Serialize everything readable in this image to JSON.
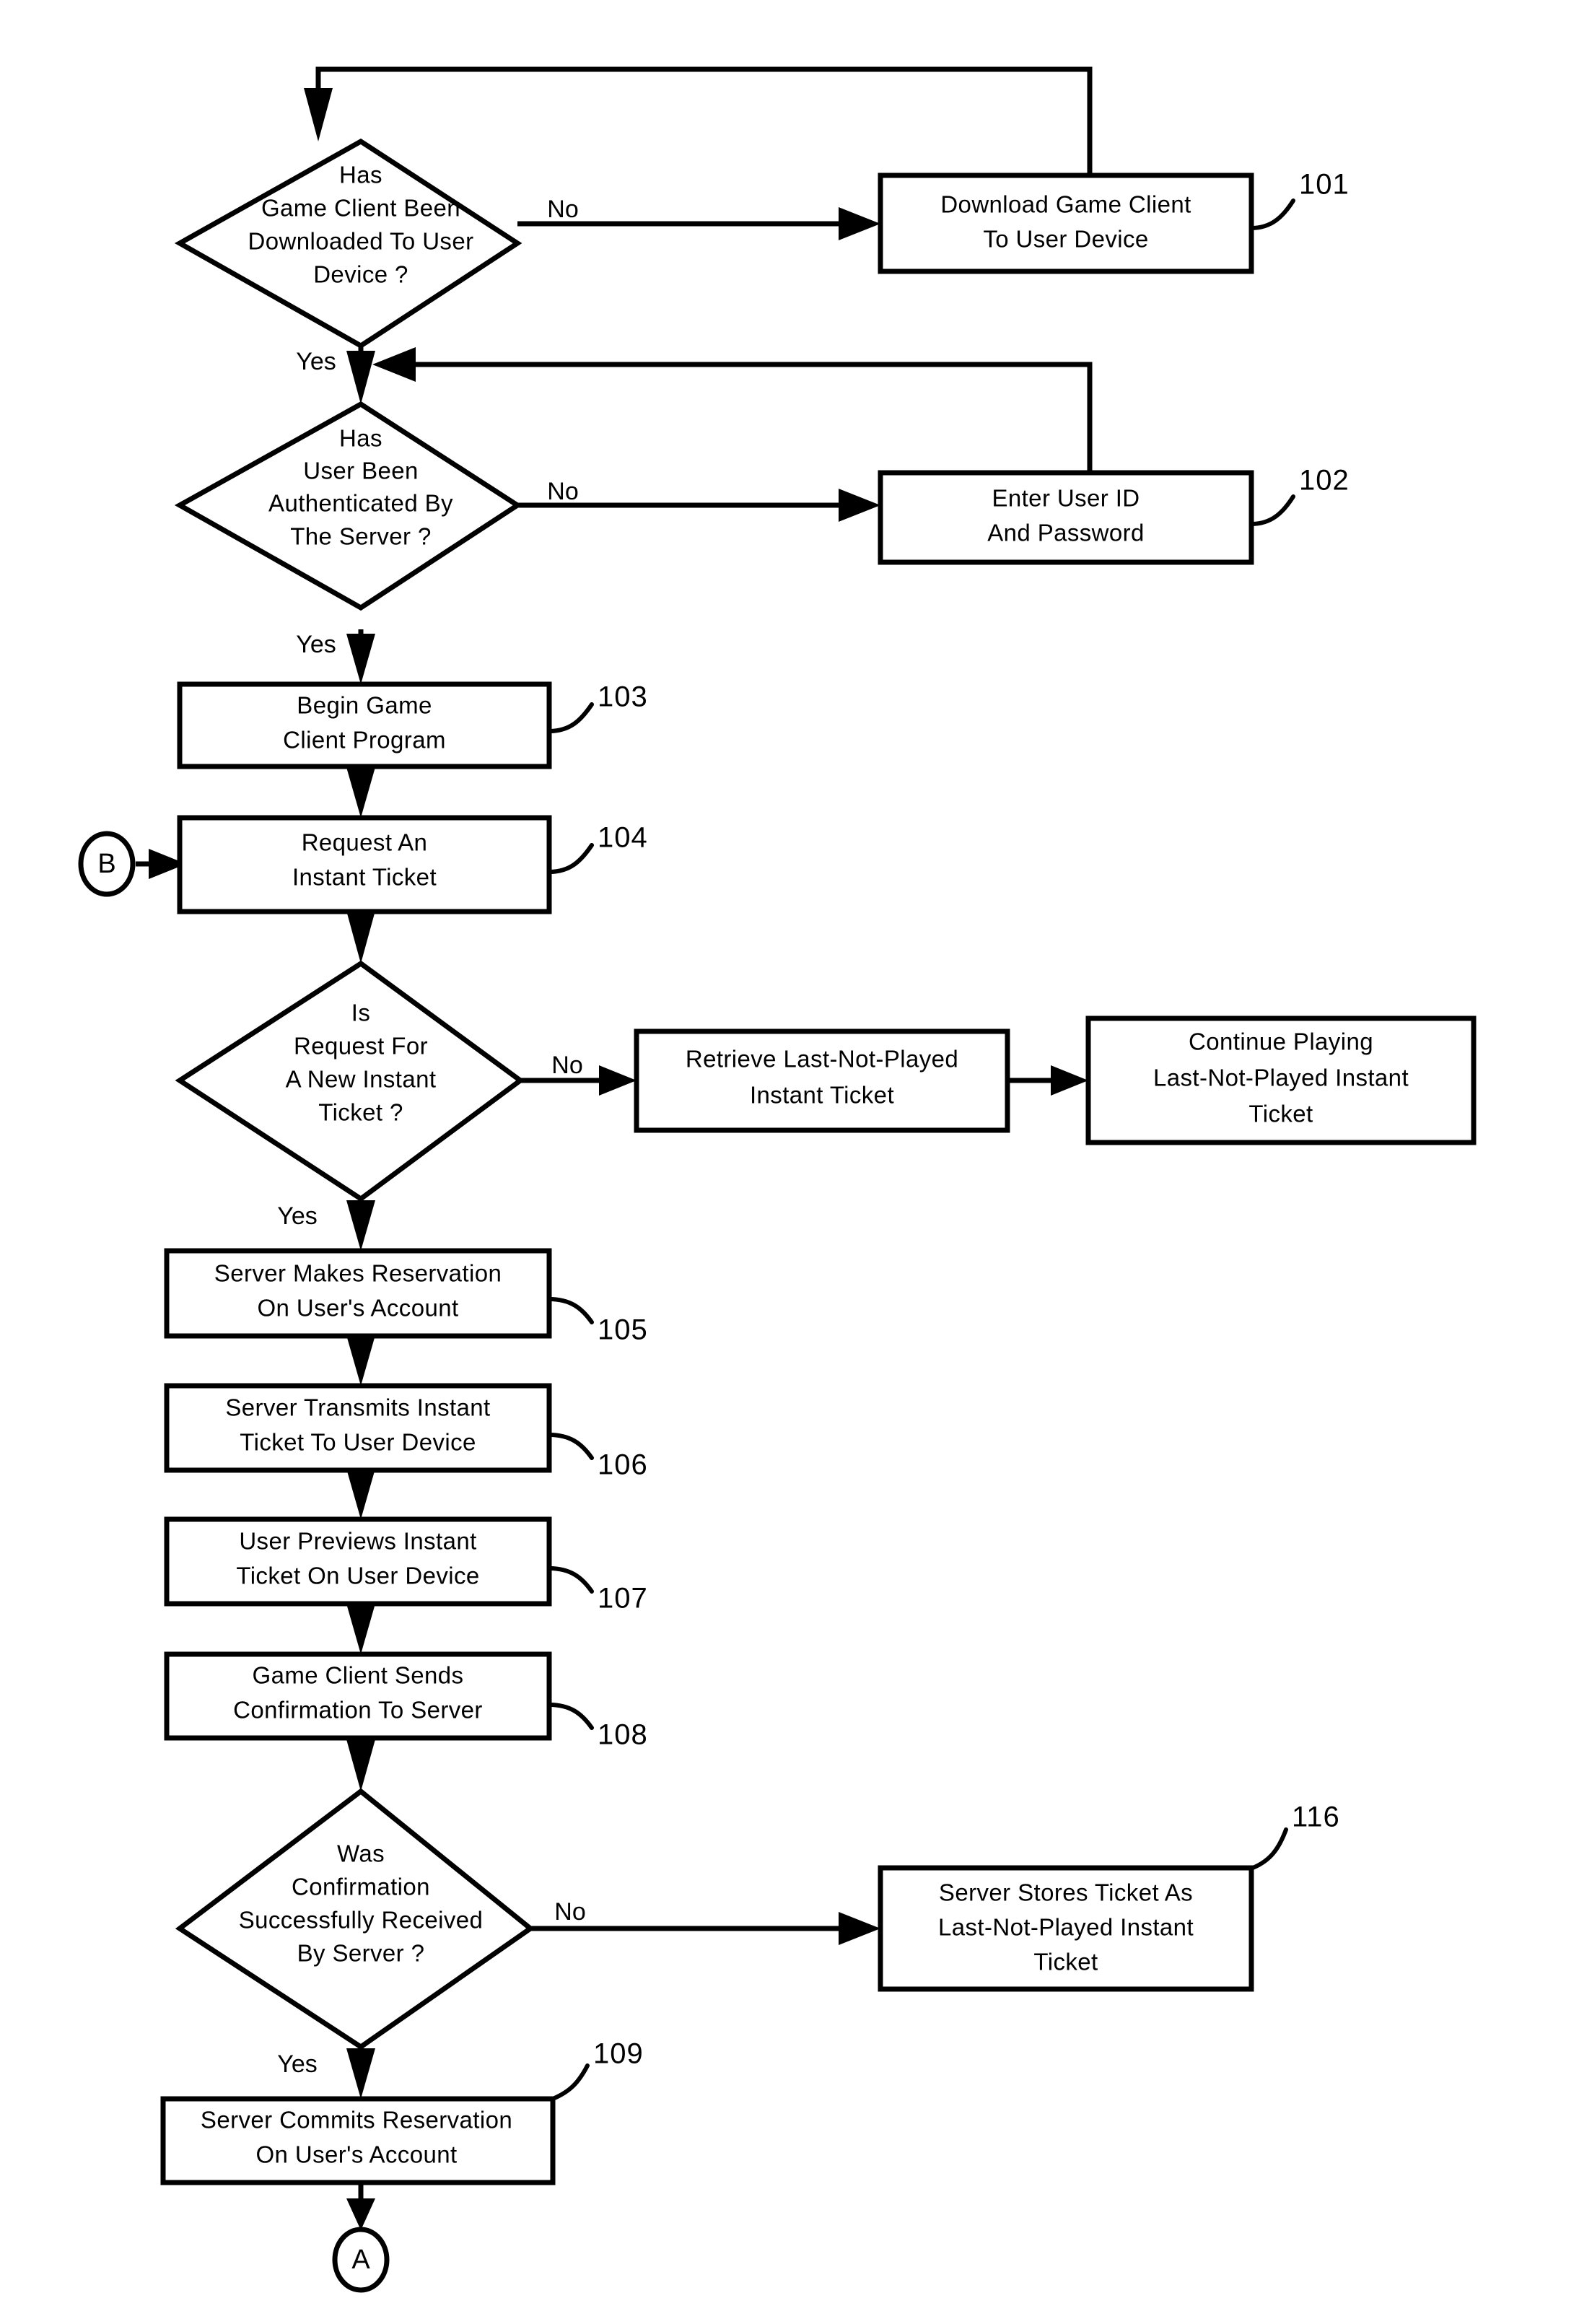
{
  "diagram": {
    "type": "flowchart",
    "title": "",
    "orientation": "top-to-bottom",
    "line_color": "#000000",
    "fill_color": "#ffffff",
    "nodes": [
      {
        "id": "d1",
        "kind": "decision",
        "ref": "",
        "lines": [
          "Has",
          "Game Client Been",
          "Downloaded To User",
          "Device ?"
        ]
      },
      {
        "id": "p101",
        "kind": "process",
        "ref": "101",
        "lines": [
          "Download Game Client",
          "To User Device"
        ]
      },
      {
        "id": "d2",
        "kind": "decision",
        "ref": "",
        "lines": [
          "Has",
          "User Been",
          "Authenticated By",
          "The Server ?"
        ]
      },
      {
        "id": "p102",
        "kind": "process",
        "ref": "102",
        "lines": [
          "Enter User ID",
          "And Password"
        ]
      },
      {
        "id": "p103",
        "kind": "process",
        "ref": "103",
        "lines": [
          "Begin Game",
          "Client Program"
        ]
      },
      {
        "id": "p104",
        "kind": "process",
        "ref": "104",
        "lines": [
          "Request An",
          "Instant Ticket"
        ]
      },
      {
        "id": "d3",
        "kind": "decision",
        "ref": "",
        "lines": [
          "Is",
          "Request For",
          "A New Instant",
          "Ticket ?"
        ]
      },
      {
        "id": "pRetrieve",
        "kind": "process",
        "ref": "",
        "lines": [
          "Retrieve Last-Not-Played",
          "Instant Ticket"
        ]
      },
      {
        "id": "pContinue",
        "kind": "process",
        "ref": "",
        "lines": [
          "Continue Playing",
          "Last-Not-Played Instant",
          "Ticket"
        ]
      },
      {
        "id": "p105",
        "kind": "process",
        "ref": "105",
        "lines": [
          "Server Makes Reservation",
          "On User's Account"
        ]
      },
      {
        "id": "p106",
        "kind": "process",
        "ref": "106",
        "lines": [
          "Server Transmits Instant",
          "Ticket To User Device"
        ]
      },
      {
        "id": "p107",
        "kind": "process",
        "ref": "107",
        "lines": [
          "User Previews Instant",
          "Ticket On User Device"
        ]
      },
      {
        "id": "p108",
        "kind": "process",
        "ref": "108",
        "lines": [
          "Game Client Sends",
          "Confirmation To Server"
        ]
      },
      {
        "id": "d4",
        "kind": "decision",
        "ref": "",
        "lines": [
          "Was",
          "Confirmation",
          "Successfully Received",
          "By Server ?"
        ]
      },
      {
        "id": "p116",
        "kind": "process",
        "ref": "116",
        "lines": [
          "Server Stores Ticket As",
          "Last-Not-Played Instant",
          "Ticket"
        ]
      },
      {
        "id": "p109",
        "kind": "process",
        "ref": "109",
        "lines": [
          "Server Commits Reservation",
          "On User's Account"
        ]
      },
      {
        "id": "connB",
        "kind": "connector",
        "ref": "",
        "lines": [
          "B"
        ]
      },
      {
        "id": "connA",
        "kind": "connector",
        "ref": "",
        "lines": [
          "A"
        ]
      }
    ],
    "edge_labels": {
      "d1_no": "No",
      "d1_yes": "Yes",
      "d2_no": "No",
      "d2_yes": "Yes",
      "d3_no": "No",
      "d3_yes": "Yes",
      "d4_no": "No",
      "d4_yes": "Yes"
    },
    "ref_numbers": [
      "101",
      "102",
      "103",
      "104",
      "105",
      "106",
      "107",
      "108",
      "109",
      "116"
    ],
    "connector_labels": [
      "B",
      "A"
    ]
  }
}
